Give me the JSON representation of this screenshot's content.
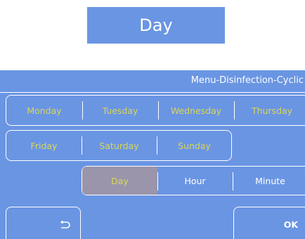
{
  "title": "Day",
  "header": {
    "menu_path": "Menu-Disinfection-Cyclic"
  },
  "days_row_1": [
    {
      "label": "Monday"
    },
    {
      "label": "Tuesday"
    },
    {
      "label": "Wednesday"
    },
    {
      "label": "Thursday"
    }
  ],
  "days_row_2": [
    {
      "label": "Friday"
    },
    {
      "label": "Saturday"
    },
    {
      "label": "Sunday"
    }
  ],
  "units": [
    {
      "label": "Day",
      "selected": true
    },
    {
      "label": "Hour",
      "selected": false
    },
    {
      "label": "Minute",
      "selected": false
    }
  ],
  "buttons": {
    "back_icon": "return-arrow-icon",
    "ok_label": "OK"
  },
  "colors": {
    "panel": "#6a95e3",
    "day_text": "#d8d65a",
    "selected_bg": "#9b95ac",
    "border": "#ffffff"
  }
}
